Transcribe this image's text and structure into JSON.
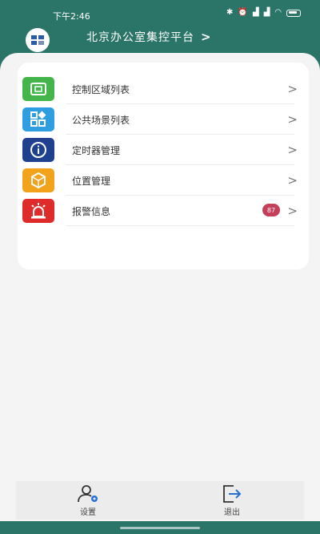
{
  "status_bar": {
    "time": "下午2:46",
    "icons": [
      "bluetooth-icon",
      "alarm-icon",
      "signal-icon",
      "signal-icon",
      "wifi-icon",
      "battery-icon"
    ]
  },
  "header": {
    "title": "北京办公室集控平台",
    "chevron": ">"
  },
  "menu": {
    "items": [
      {
        "label": "控制区域列表",
        "icon": "control-area-icon",
        "color": "#43b54a"
      },
      {
        "label": "公共场景列表",
        "icon": "scene-grid-icon",
        "color": "#2e9ee0"
      },
      {
        "label": "定时器管理",
        "icon": "info-timer-icon",
        "color": "#1f3f8f"
      },
      {
        "label": "位置管理",
        "icon": "box-location-icon",
        "color": "#f2a31b"
      },
      {
        "label": "报警信息",
        "icon": "alarm-light-icon",
        "color": "#e02b2b",
        "badge": "87"
      }
    ],
    "chevron": ">"
  },
  "bottom_nav": {
    "settings_label": "设置",
    "logout_label": "退出"
  },
  "colors": {
    "header_bg": "#2a7468",
    "panel_bg": "#f4f4f4",
    "badge": "#c4405a"
  }
}
